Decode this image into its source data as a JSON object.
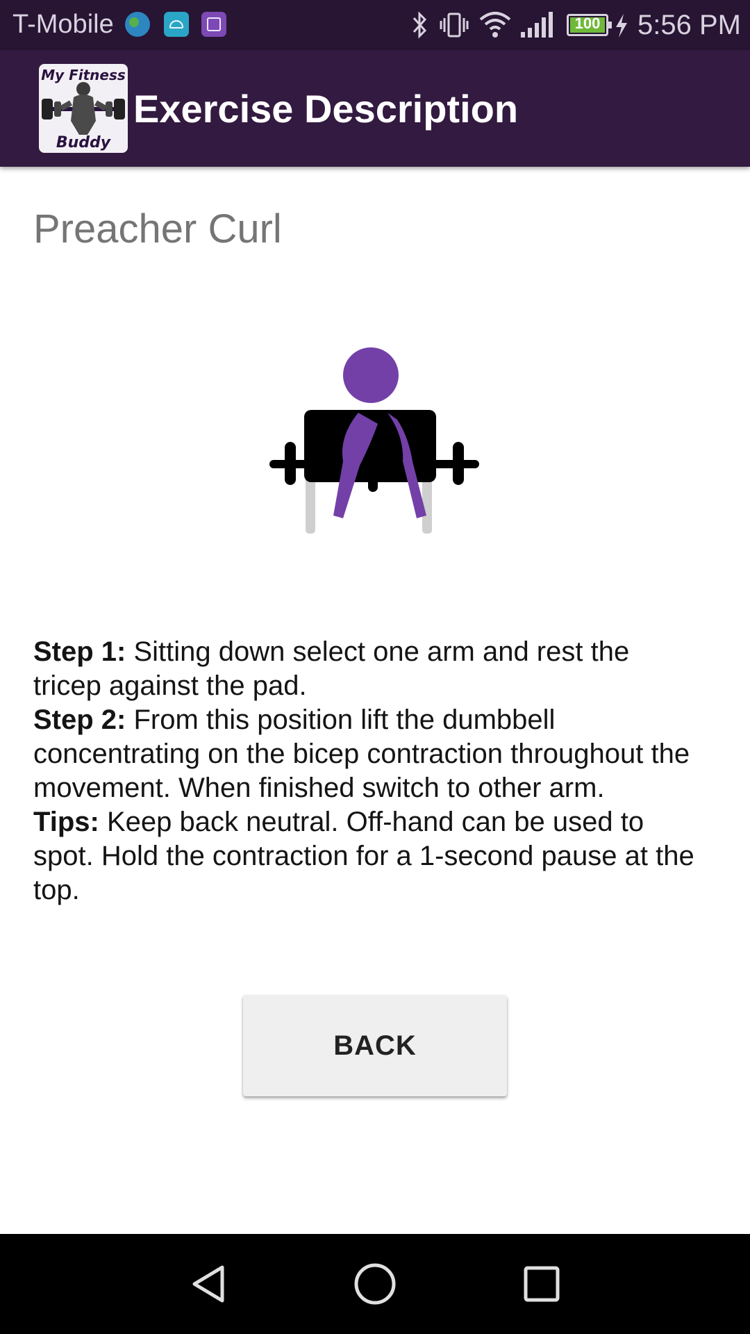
{
  "status_bar": {
    "carrier": "T-Mobile",
    "battery_level": "100",
    "battery_fraction": 1.0,
    "time": "5:56 PM",
    "notification_icons": [
      "globe-icon",
      "android-icon",
      "gallery-icon"
    ],
    "status_icons": [
      "bluetooth-icon",
      "vibrate-icon",
      "wifi-icon",
      "cell-signal-icon",
      "battery-icon",
      "charging-icon"
    ]
  },
  "app_bar": {
    "logo_top": "My Fitness",
    "logo_bottom": "Buddy",
    "title": "Exercise Description"
  },
  "exercise": {
    "name": "Preacher Curl",
    "steps": [
      {
        "label": "Step 1:",
        "text": " Sitting down select one arm and rest the tricep against the pad."
      },
      {
        "label": "Step 2:",
        "text": " From this position lift the dumbbell concentrating on the bicep contraction throughout the movement. When finished switch to other arm."
      },
      {
        "label": "Tips:",
        "text": " Keep back neutral. Off-hand can be used to spot. Hold the contraction for a 1-second pause at the top."
      }
    ]
  },
  "actions": {
    "back_label": "BACK"
  },
  "nav_bar": {
    "icons": [
      "back-nav-icon",
      "home-nav-icon",
      "recents-nav-icon"
    ]
  },
  "colors": {
    "status_bar": "#271533",
    "app_bar": "#331a40",
    "accent_purple": "#7340a8",
    "battery_green": "#6fb83a"
  }
}
